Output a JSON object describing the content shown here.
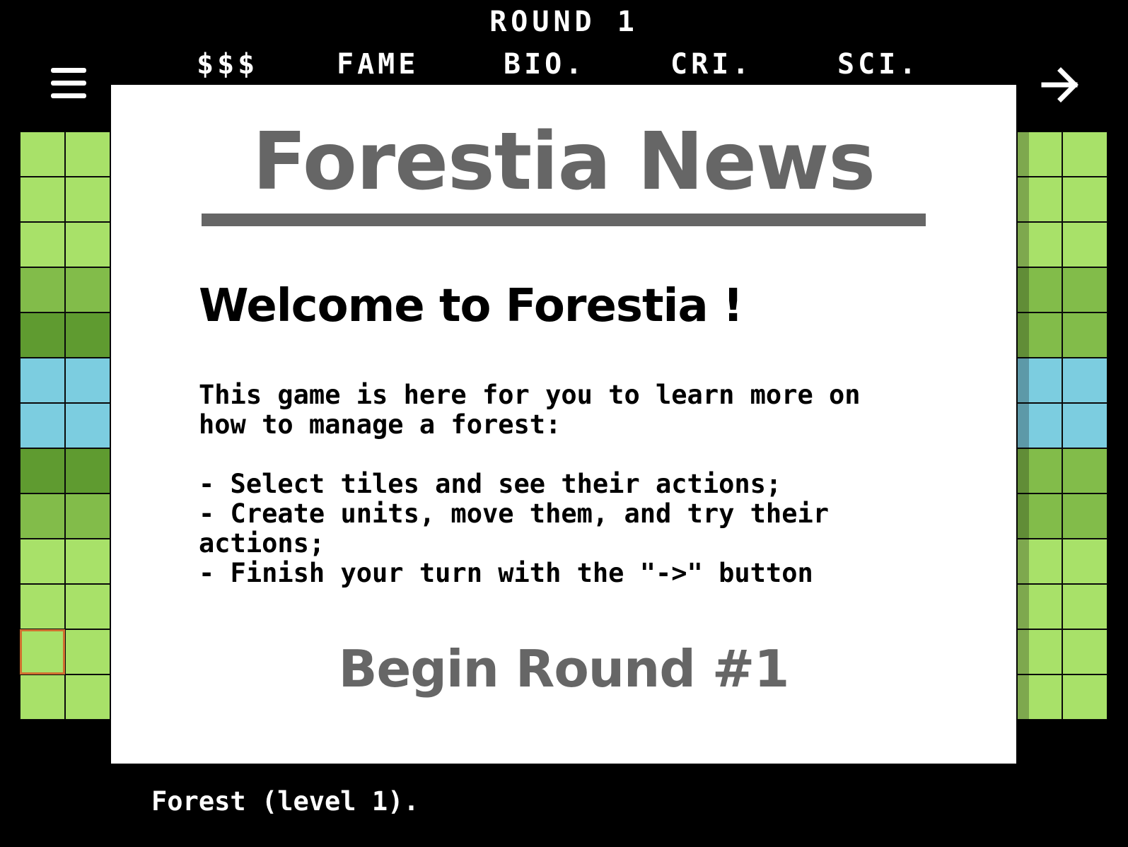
{
  "header": {
    "round_label": "ROUND  1",
    "stats": [
      "$$$",
      "FAME",
      "BIO.",
      "CRI.",
      "SCI."
    ]
  },
  "icons": {
    "menu": "hamburger-menu-icon",
    "next": "arrow-right-icon"
  },
  "map": {
    "left_columns": [
      [
        "light",
        "light",
        "light",
        "mid",
        "dark",
        "water",
        "water",
        "dark",
        "mid",
        "light",
        "light",
        "light",
        "light"
      ],
      [
        "light",
        "light",
        "light",
        "mid",
        "dark",
        "water",
        "water",
        "dark",
        "mid",
        "light",
        "light",
        "light",
        "light"
      ]
    ],
    "right_columns": [
      [
        "light",
        "light",
        "light",
        "mid",
        "mid",
        "water",
        "water",
        "mid",
        "mid",
        "light",
        "light",
        "light",
        "light"
      ],
      [
        "light",
        "light",
        "light",
        "mid",
        "mid",
        "water",
        "water",
        "mid",
        "mid",
        "light",
        "light",
        "light",
        "light"
      ]
    ],
    "tile_colors": {
      "light": "#a8e169",
      "mid": "#82bc4a",
      "dark": "#5f9b30",
      "water": "#7ccde0"
    },
    "selected_color": "#d07030"
  },
  "news": {
    "title": "Forestia News",
    "welcome": "Welcome to Forestia !",
    "body": "This game is here for you to learn more on\nhow to manage a forest:\n\n- Select tiles and see their actions;\n- Create units, move them, and try their\nactions;\n- Finish your turn with the \"->\" button",
    "begin_label": "Begin Round #1"
  },
  "status": {
    "text": "Forest (level 1)."
  }
}
